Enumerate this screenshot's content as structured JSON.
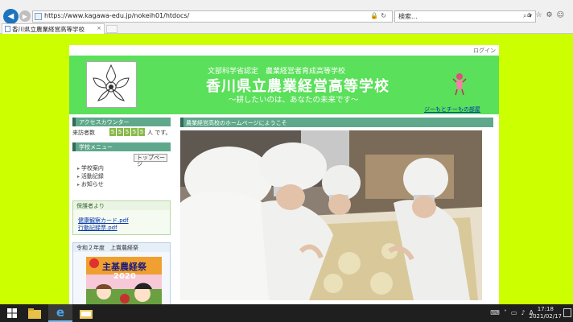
{
  "browser": {
    "url": "https://www.kagawa-edu.jp/nokeih01/htdocs/",
    "search_query": "検索...",
    "tab_title": "香川県立農業経営高等学校",
    "tab_close": "×"
  },
  "page": {
    "login": "ログイン",
    "banner": {
      "certification": "文部科学省認定　農業経営者育成高等学校",
      "school_name": "香川県立農業経営高等学校",
      "slogan": "～耕したいのは、あなたの未来です～",
      "mascot_link": "ジーもとチーもの部屋"
    },
    "sidebar": {
      "counter_header": "アクセスカウンター",
      "counter_label": "来訪者数",
      "counter_digits": [
        "5",
        "5",
        "5",
        "5",
        "5"
      ],
      "counter_suffix": "人 です。",
      "menu_header": "学校メニュー",
      "top_page": "トップページ",
      "menu_items": [
        "学校案内",
        "活動記録",
        "お知らせ"
      ],
      "guardian_header": "保護者より",
      "guardian_links": [
        "健康観察カード.pdf",
        "行動記録票.pdf"
      ],
      "year2_header": "令和２年度　上賞農経祭",
      "poster_title": "主基農経祭",
      "poster_year": "2020"
    },
    "main": {
      "header": "農業経営高校のホームページにようこそ"
    }
  },
  "taskbar": {
    "time": "17:18",
    "date": "2021/02/17"
  },
  "colors": {
    "background": "#ccff00",
    "banner": "#5ae05a",
    "section_header": "#5fa88c"
  }
}
